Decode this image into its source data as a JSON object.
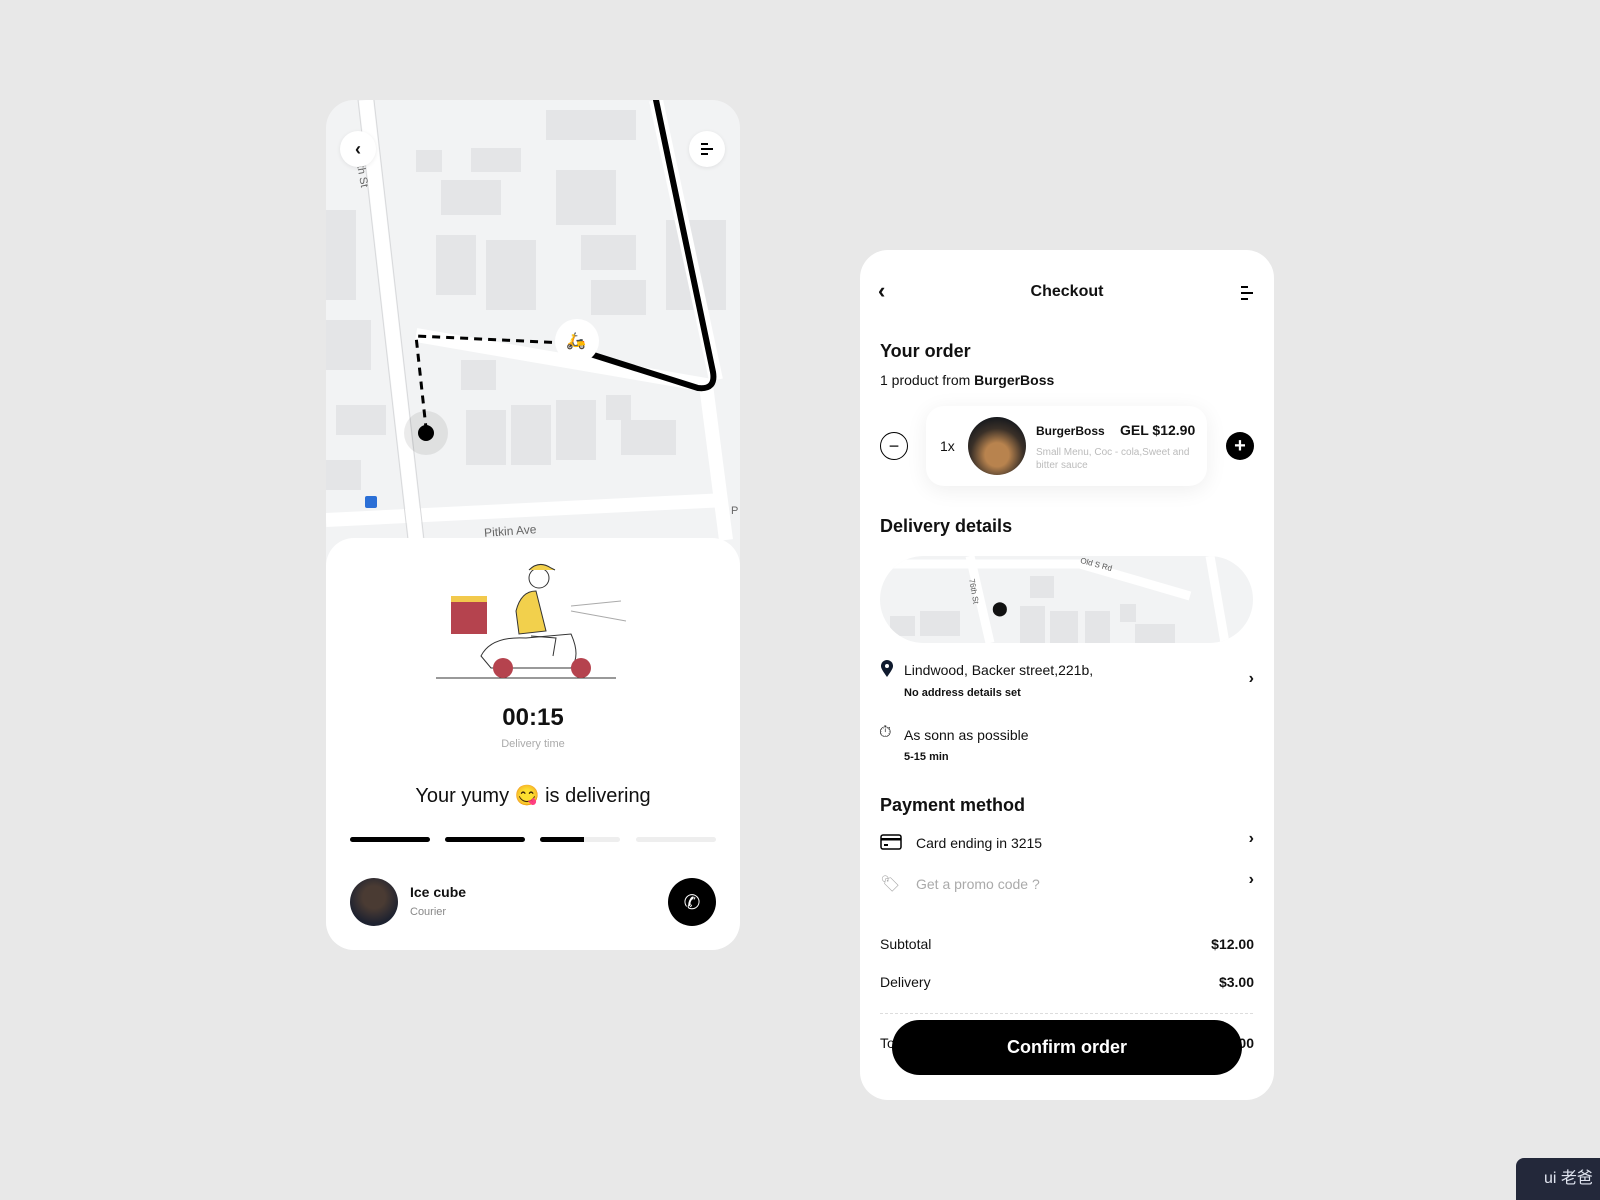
{
  "tracking": {
    "map": {
      "street_1": "76th St",
      "street_2": "Pitkin Ave",
      "edge_label": "P"
    },
    "time": "00:15",
    "time_label": "Delivery time",
    "status_text": "Your yumy 😋 is delivering",
    "progress_steps": [
      1,
      1,
      0.55,
      0
    ],
    "courier": {
      "name": "Ice cube",
      "role": "Courier"
    }
  },
  "checkout": {
    "title": "Checkout",
    "your_order": "Your order",
    "product_count_prefix": "1 product from ",
    "restaurant": "BurgerBoss",
    "item": {
      "qty": "1x",
      "name": "BurgerBoss",
      "price": "GEL $12.90",
      "description": "Small Menu, Coc - cola,Sweet and bitter sauce"
    },
    "delivery_details": "Delivery details",
    "map": {
      "street_1": "76th St",
      "street_2": "Old S Rd"
    },
    "address": "Lindwood, Backer street,221b,",
    "address_note": "No address details set",
    "timing": "As sonn as possible",
    "timing_range": "5-15 min",
    "payment_method": "Payment method",
    "card": "Card ending in 3215",
    "promo_placeholder": "Get a promo code ?",
    "subtotal_label": "Subtotal",
    "subtotal": "$12.00",
    "delivery_label": "Delivery",
    "delivery": "$3.00",
    "total_label": "Total",
    "total": "$15.00",
    "confirm": "Confirm order"
  },
  "watermark": "ui 老爸"
}
